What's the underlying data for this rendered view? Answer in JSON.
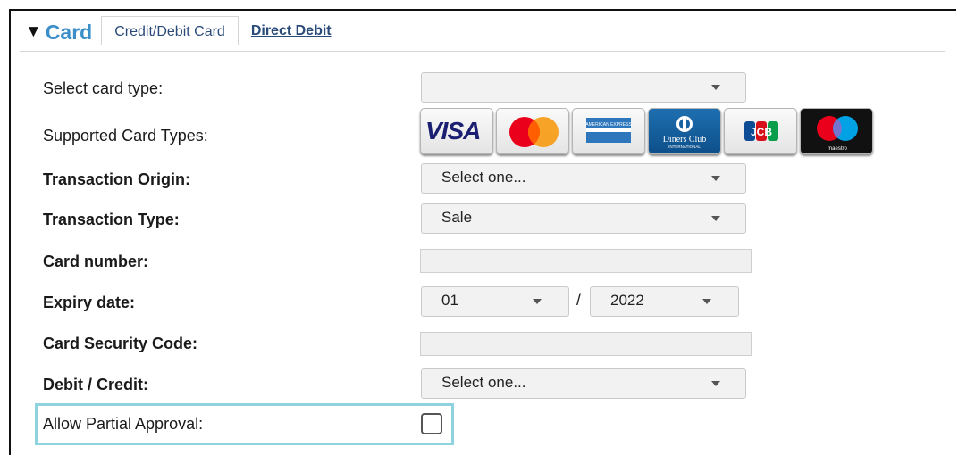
{
  "section": {
    "title": "Card",
    "tabs": [
      {
        "label": "Credit/Debit Card",
        "active": true
      },
      {
        "label": "Direct Debit",
        "active": false
      }
    ]
  },
  "form": {
    "select_card_type": {
      "label": "Select card type:",
      "value": ""
    },
    "supported_card_types": {
      "label": "Supported Card Types:",
      "cards": [
        {
          "name": "visa-card-icon",
          "text": "VISA"
        },
        {
          "name": "mastercard-card-icon"
        },
        {
          "name": "amex-card-icon",
          "text": "AMERICAN EXPRESS"
        },
        {
          "name": "diners-club-card-icon",
          "text": "Diners Club",
          "subtext": "INTERNATIONAL"
        },
        {
          "name": "jcb-card-icon",
          "text": "JCB"
        },
        {
          "name": "maestro-card-icon",
          "text": "maestro"
        }
      ]
    },
    "transaction_origin": {
      "label": "Transaction Origin:",
      "value": "Select one..."
    },
    "transaction_type": {
      "label": "Transaction Type:",
      "value": "Sale"
    },
    "card_number": {
      "label": "Card number:",
      "value": ""
    },
    "expiry_date": {
      "label": "Expiry date:",
      "month": "01",
      "separator": "/",
      "year": "2022"
    },
    "card_security_code": {
      "label": "Card Security Code:",
      "value": ""
    },
    "debit_credit": {
      "label": "Debit / Credit:",
      "value": "Select one..."
    },
    "allow_partial_approval": {
      "label": "Allow Partial Approval:",
      "checked": false
    }
  },
  "colors": {
    "accent": "#3a8fc9",
    "highlight": "#8fd3e0"
  }
}
